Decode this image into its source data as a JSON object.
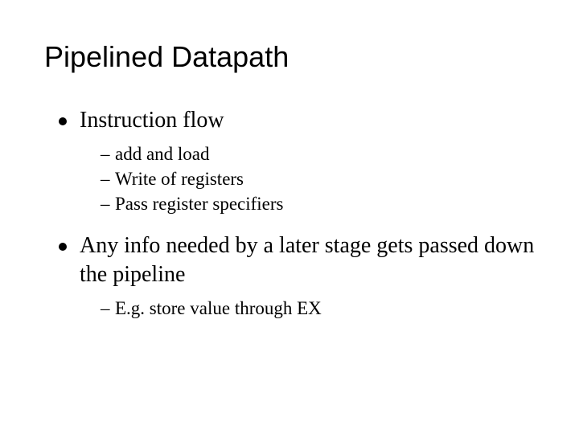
{
  "title": "Pipelined Datapath",
  "bullets": [
    {
      "text": "Instruction flow",
      "subs": [
        "add and load",
        "Write of registers",
        "Pass register specifiers"
      ]
    },
    {
      "text": "Any info needed by a later stage gets passed down the pipeline",
      "subs": [
        "E.g. store value through EX"
      ]
    }
  ]
}
